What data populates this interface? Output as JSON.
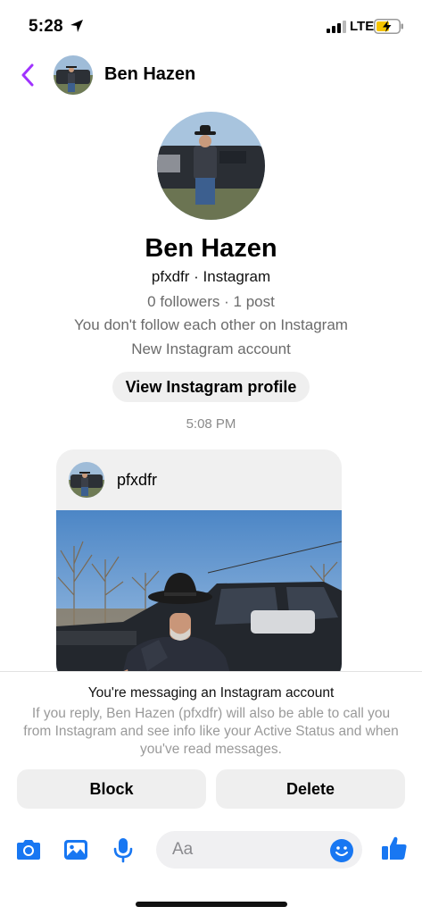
{
  "status_bar": {
    "time": "5:28",
    "network": "LTE",
    "icons": [
      "location-arrow-icon",
      "signal-icon",
      "battery-charging-icon"
    ]
  },
  "header": {
    "name": "Ben Hazen",
    "back_icon": "chevron-left-icon"
  },
  "profile": {
    "name": "Ben Hazen",
    "subtitle": "pfxdfr · Instagram",
    "stats": "0 followers · 1 post",
    "follow_status": "You don't follow each other on Instagram",
    "account_note": "New Instagram account",
    "view_button": "View Instagram profile"
  },
  "conversation": {
    "timestamp": "5:08 PM",
    "shared_post": {
      "username": "pfxdfr"
    }
  },
  "notice": {
    "title": "You're messaging an Instagram account",
    "body": "If you reply, Ben Hazen (pfxdfr) will also be able to call you from Instagram and see info like your Active Status and when you've read messages.",
    "block_label": "Block",
    "delete_label": "Delete"
  },
  "composer": {
    "placeholder": "Aa",
    "icons": [
      "camera-icon",
      "image-icon",
      "microphone-icon",
      "emoji-icon",
      "thumbs-up-icon"
    ]
  },
  "colors": {
    "accent_purple": "#a033ff",
    "icon_blue": "#1877f2",
    "button_gray": "#efefef"
  }
}
